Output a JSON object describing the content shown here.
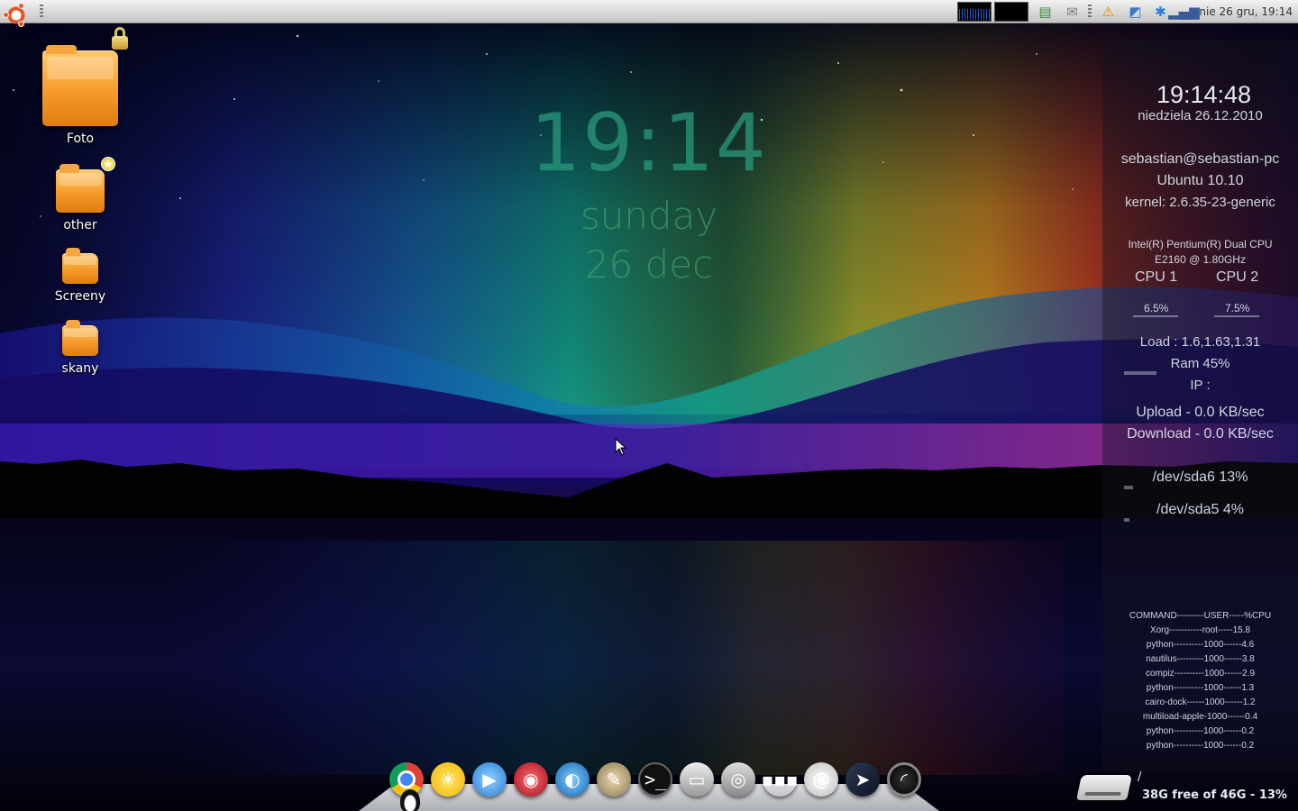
{
  "top_panel": {
    "clock": "nie 26 gru, 19:14",
    "tray_icons": [
      "system-monitor-graph",
      "network-graph",
      "notes-icon",
      "mail-icon",
      "warning-icon",
      "update-notifier-icon",
      "bluetooth-icon",
      "signal-icon"
    ]
  },
  "desktop": {
    "icons": [
      {
        "label": "Foto",
        "icon": "folder-icon",
        "emblem": "lock-icon"
      },
      {
        "label": "other",
        "icon": "folder-icon",
        "emblem": "star-icon"
      },
      {
        "label": "Screeny",
        "icon": "folder-icon"
      },
      {
        "label": "skany",
        "icon": "folder-icon"
      }
    ]
  },
  "center_clock": {
    "time": "19:14",
    "day": "sunday",
    "date": "26 dec"
  },
  "conky": {
    "time": "19:14:48",
    "date": "niedziela 26.12.2010",
    "user": "sebastian@sebastian-pc",
    "os": "Ubuntu 10.10",
    "kernel": "kernel: 2.6.35-23-generic",
    "cpu_model": "Intel(R) Pentium(R) Dual  CPU  E2160  @ 1.80GHz",
    "cpu1_label": "CPU 1",
    "cpu2_label": "CPU 2",
    "cpu1_value": "6.5%",
    "cpu2_value": "7.5%",
    "cpu1_percent": 6.5,
    "cpu2_percent": 7.5,
    "load": "Load : 1.6,1.63,1.31",
    "ram": "Ram 45%",
    "ram_percent": 45,
    "ip": "IP :",
    "upload": "Upload - 0.0 KB/sec",
    "download": "Download - 0.0 KB/sec",
    "sda6": "/dev/sda6 13%",
    "sda6_percent": 13,
    "sda5": "/dev/sda5 4%",
    "sda5_percent": 4,
    "processes": [
      "COMMAND---------USER-----%CPU",
      "Xorg-----------root-----15.8",
      "python----------1000------4.6",
      "nautilus---------1000------3.8",
      "compiz----------1000------2.9",
      "python----------1000------1.3",
      "cairo-dock------1000------1.2",
      "multiload-apple-1000------0.4",
      "python----------1000------0.2",
      "python----------1000------0.2"
    ]
  },
  "drive": {
    "path": "/",
    "free": "38G free of 46G - 13%"
  },
  "dock": {
    "items": [
      "chrome-icon",
      "sun-weather-icon",
      "chat-icon",
      "red-app-icon",
      "fish-browser-icon",
      "gimp-icon",
      "terminal-icon",
      "scanner-icon",
      "camera-icon",
      "grid-icon",
      "email-icon",
      "cursor-app-icon",
      "speedometer-icon"
    ]
  },
  "colors": {
    "panel": "#d6d6d6",
    "clock_green": "#2a9678",
    "conky_text": "#cfd5de"
  }
}
